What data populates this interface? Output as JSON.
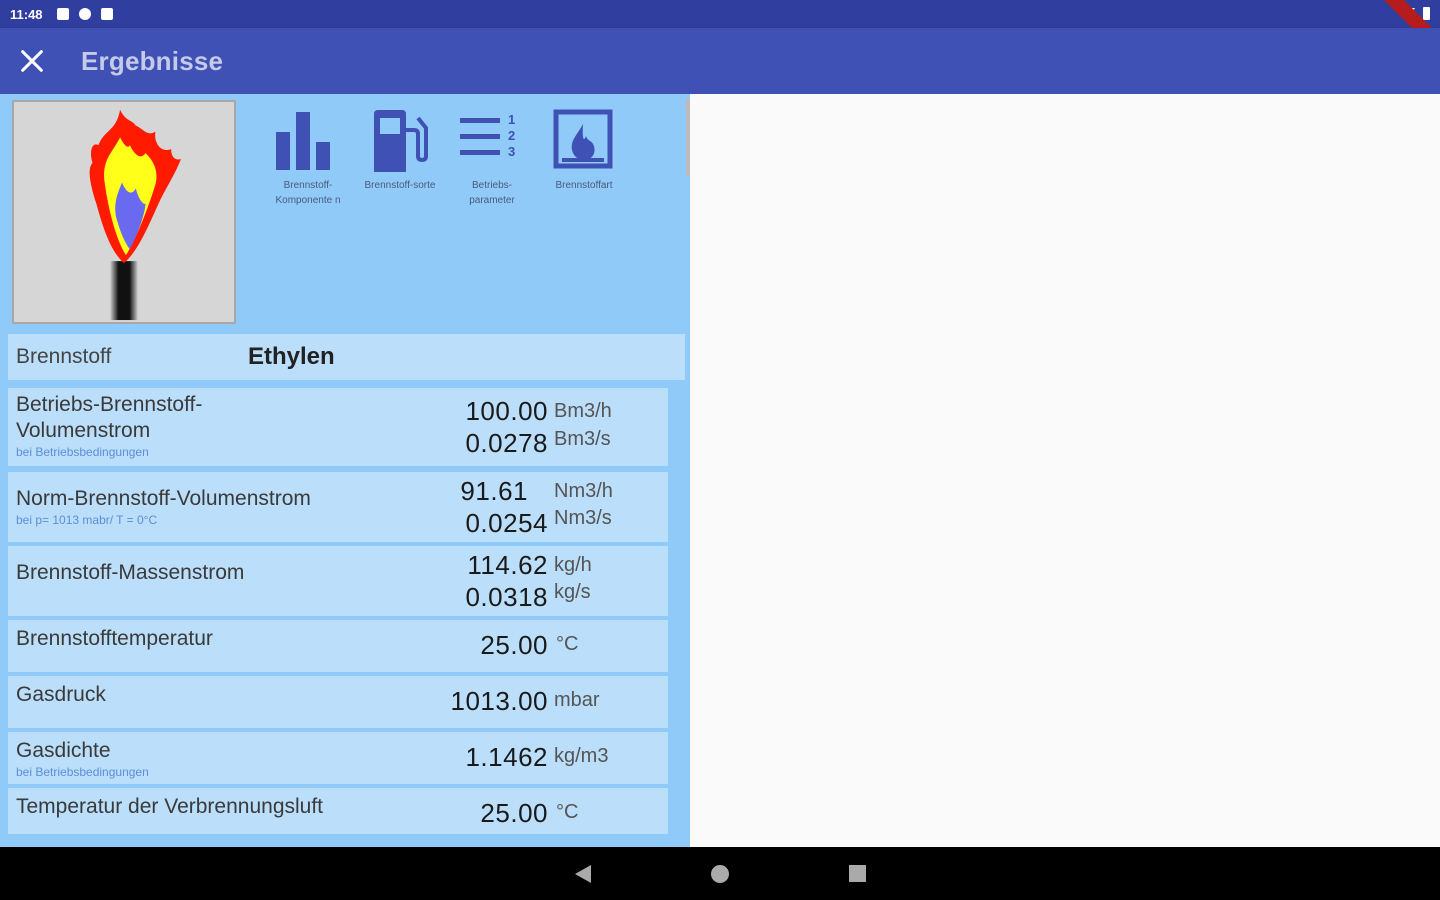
{
  "status": {
    "time": "11:48"
  },
  "appbar": {
    "title": "Ergebnisse",
    "close_icon": "close-icon"
  },
  "toolbar": {
    "items": [
      {
        "label": "Brennstoff-Komponente n",
        "icon": "bar-chart-icon"
      },
      {
        "label": "Brennstoff-sorte",
        "icon": "fuel-pump-icon"
      },
      {
        "label": "Betriebs-parameter",
        "icon": "numbered-list-icon"
      },
      {
        "label": "Brennstoffart",
        "icon": "flame-image-icon"
      }
    ]
  },
  "fuel": {
    "label": "Brennstoff",
    "value": "Ethylen"
  },
  "rows": [
    {
      "label_line1": "Betriebs-Brennstoff-",
      "label_line2": "Volumenstrom",
      "sub": "bei Betriebsbedingungen",
      "v1": "100.00",
      "u1": "Bm3/h",
      "v2": "0.0278",
      "u2": "Bm3/s"
    },
    {
      "label": "Norm-Brennstoff-Volumenstrom",
      "sub": "bei p= 1013 mabr/ T = 0°C",
      "v1": "91.61",
      "u1": "Nm3/h",
      "v2": "0.0254",
      "u2": "Nm3/s"
    },
    {
      "label": "Brennstoff-Massenstrom",
      "v1": "114.62",
      "u1": "kg/h",
      "v2": "0.0318",
      "u2": "kg/s"
    },
    {
      "label": "Brennstofftemperatur",
      "v1": "25.00",
      "u1": "°C"
    },
    {
      "label": "Gasdruck",
      "v1": "1013.00",
      "u1": "mbar"
    },
    {
      "label": "Gasdichte",
      "sub": "bei Betriebsbedingungen",
      "v1": "1.1462",
      "u1": "kg/m3"
    },
    {
      "label": "Temperatur der Verbrennungsluft",
      "v1": "25.00",
      "u1": "°C"
    }
  ],
  "colors": {
    "appbar": "#3f51b5",
    "statusbar": "#303f9f",
    "panel": "#90caf9",
    "row": "#bbdefb"
  }
}
